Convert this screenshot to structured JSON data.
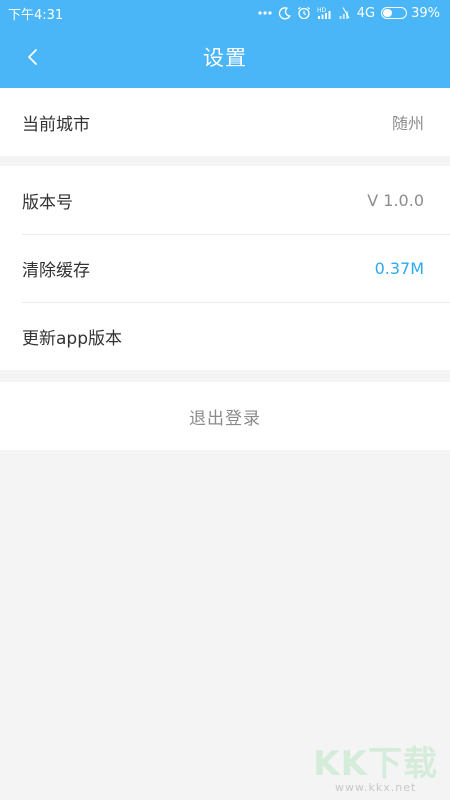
{
  "status_bar": {
    "time": "下午4:31",
    "network": "4G",
    "battery": "39%",
    "battery_level": 0.39,
    "icons": [
      "more-dots-icon",
      "moon-icon",
      "alarm-icon",
      "hd-signal-icon",
      "signal-icon"
    ]
  },
  "header": {
    "title": "设置",
    "back_icon": "chevron-left-icon"
  },
  "group1": [
    {
      "label": "当前城市",
      "value": "随州"
    }
  ],
  "group2": [
    {
      "label": "版本号",
      "value": "V 1.0.0"
    },
    {
      "label": "清除缓存",
      "value": "0.37M"
    },
    {
      "label": "更新app版本",
      "value": ""
    }
  ],
  "logout_label": "退出登录",
  "watermark": {
    "logo": "KK下载",
    "url": "www.kkx.net"
  },
  "colors": {
    "primary": "#4ab6f7",
    "accent_value": "#2ea8f0",
    "background": "#f4f4f4"
  }
}
